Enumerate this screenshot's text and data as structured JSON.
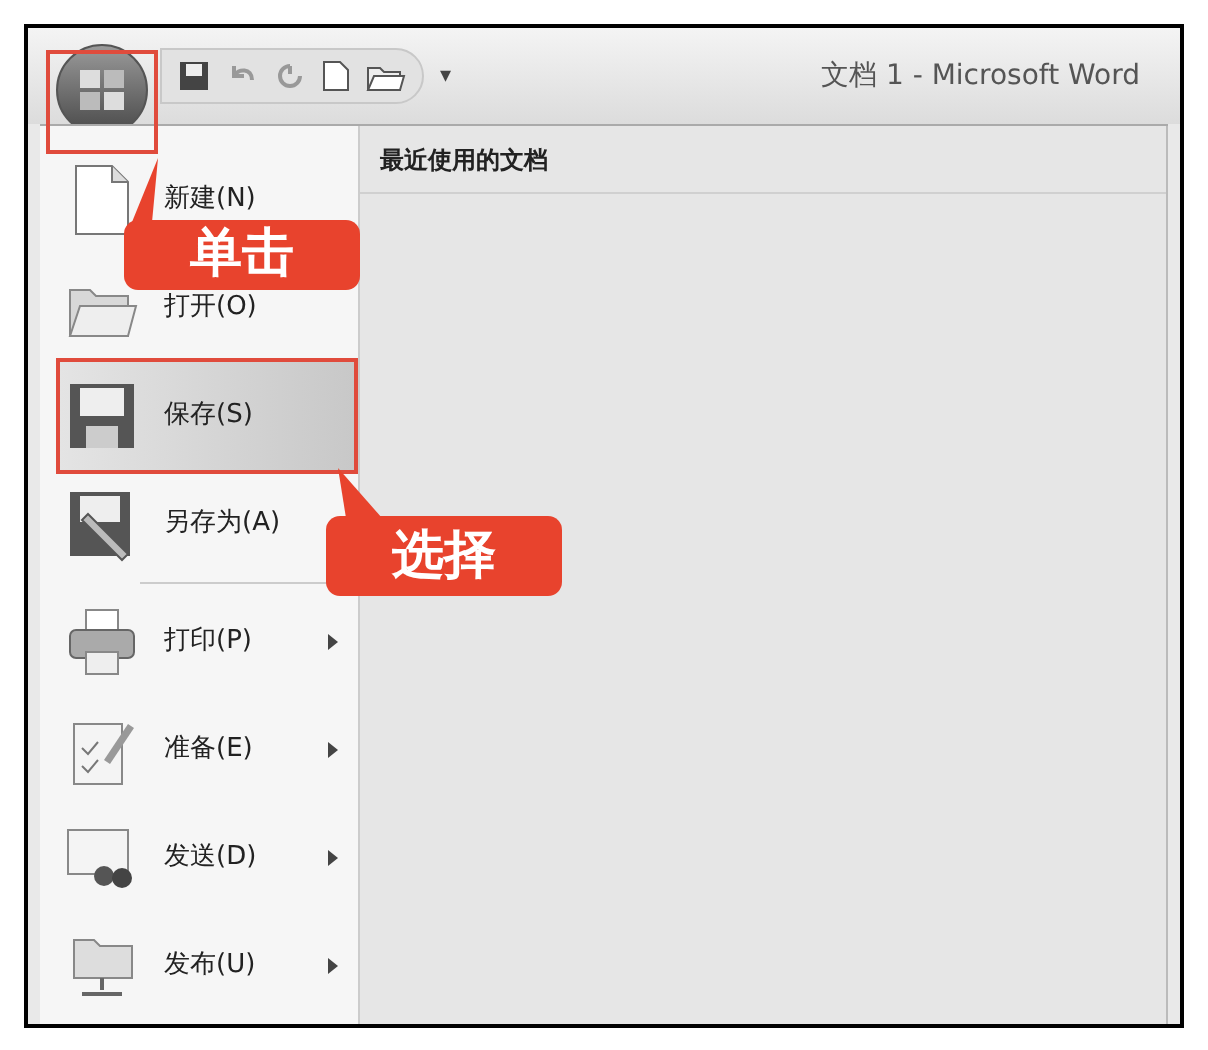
{
  "window": {
    "title": "文档 1 - Microsoft Word"
  },
  "quick_access": {
    "more": "▾"
  },
  "menu": {
    "items": [
      {
        "kind": "new",
        "label": "新建(N)",
        "submenu": false,
        "selected": false
      },
      {
        "kind": "open",
        "label": "打开(O)",
        "submenu": false,
        "selected": false
      },
      {
        "kind": "save",
        "label": "保存(S)",
        "submenu": false,
        "selected": true
      },
      {
        "kind": "saveas",
        "label": "另存为(A)",
        "submenu": false,
        "selected": false
      },
      {
        "kind": "print",
        "label": "打印(P)",
        "submenu": true,
        "selected": false
      },
      {
        "kind": "prepare",
        "label": "准备(E)",
        "submenu": true,
        "selected": false
      },
      {
        "kind": "send",
        "label": "发送(D)",
        "submenu": true,
        "selected": false
      },
      {
        "kind": "publish",
        "label": "发布(U)",
        "submenu": true,
        "selected": false
      }
    ]
  },
  "recent": {
    "title": "最近使用的文档"
  },
  "callouts": [
    {
      "text": "单击"
    },
    {
      "text": "选择"
    }
  ]
}
